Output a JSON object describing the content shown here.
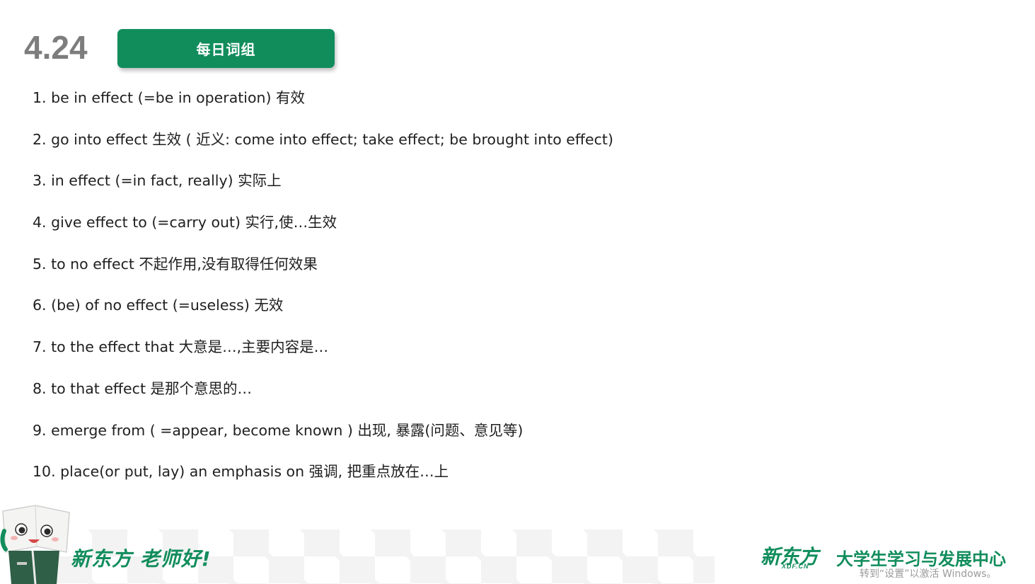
{
  "header": {
    "date": "4.24",
    "title": "每日词组"
  },
  "phrases": [
    "1. be in effect (=be in operation) 有效",
    "2. go into effect 生效 ( 近义: come into effect; take effect; be brought into effect)",
    "3. in effect (=in fact, really) 实际上",
    "4. give effect to (=carry out) 实行,使…生效",
    "5. to no effect 不起作用,没有取得任何效果",
    "6. (be) of no effect (=useless) 无效",
    "7. to the effect that 大意是…,主要内容是…",
    "8. to that effect 是那个意思的…",
    "9. emerge from ( =appear, become known ) 出现, 暴露(问题、意见等)",
    "10. place(or put, lay) an emphasis on 强调, 把重点放在…上"
  ],
  "footer": {
    "slogan": "新东方 老师好!",
    "logo_text": "新东方",
    "logo_sub": "XDF.CN",
    "center_name": "大学生学习与发展中心",
    "watermark": "转到“设置”以激活 Windows。",
    "mascot_icon": "book-mascot-icon"
  },
  "colors": {
    "brand_green": "#118d5c",
    "date_gray": "#7d7d7d",
    "text": "#1f1f1f"
  }
}
